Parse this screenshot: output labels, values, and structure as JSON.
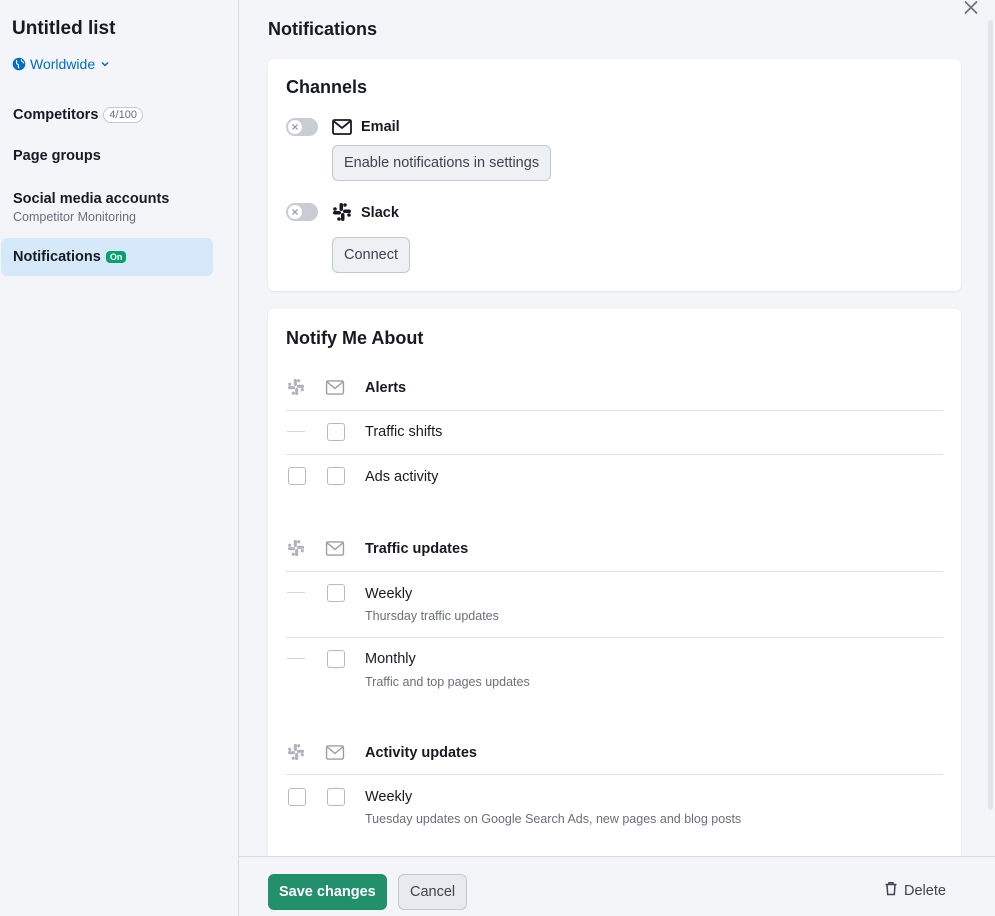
{
  "sidebar": {
    "title": "Untitled list",
    "region": "Worldwide",
    "items": [
      {
        "label": "Competitors",
        "badge": "4/100"
      },
      {
        "label": "Page groups"
      },
      {
        "label": "Social media accounts",
        "sub": "Competitor Monitoring"
      },
      {
        "label": "Notifications",
        "badge": "On",
        "active": true
      }
    ]
  },
  "page": {
    "title": "Notifications"
  },
  "channels": {
    "title": "Channels",
    "email": {
      "name": "Email",
      "enabled": false,
      "action": "Enable notifications in settings"
    },
    "slack": {
      "name": "Slack",
      "enabled": false,
      "action": "Connect"
    }
  },
  "notify": {
    "title": "Notify Me About",
    "groups": [
      {
        "title": "Alerts",
        "options": [
          {
            "label": "Traffic shifts",
            "slack": "unavailable",
            "email": false
          },
          {
            "label": "Ads activity",
            "slack": false,
            "email": false
          }
        ]
      },
      {
        "title": "Traffic updates",
        "options": [
          {
            "label": "Weekly",
            "sub": "Thursday traffic updates",
            "slack": "unavailable",
            "email": false
          },
          {
            "label": "Monthly",
            "sub": "Traffic and top pages updates",
            "slack": "unavailable",
            "email": false
          }
        ]
      },
      {
        "title": "Activity updates",
        "options": [
          {
            "label": "Weekly",
            "sub": "Tuesday updates on Google Search Ads, new pages and blog posts",
            "slack": false,
            "email": false
          }
        ]
      }
    ]
  },
  "footer": {
    "save": "Save changes",
    "cancel": "Cancel",
    "delete": "Delete"
  },
  "colors": {
    "accent_link": "#006dca",
    "primary_button": "#21906b",
    "on_badge": "#0aa16f",
    "active_nav": "#d5e9fb"
  },
  "icons": [
    "globe-icon",
    "chevron-down-icon",
    "close-icon",
    "mail-icon",
    "slack-icon",
    "trash-icon",
    "x-small-icon"
  ]
}
